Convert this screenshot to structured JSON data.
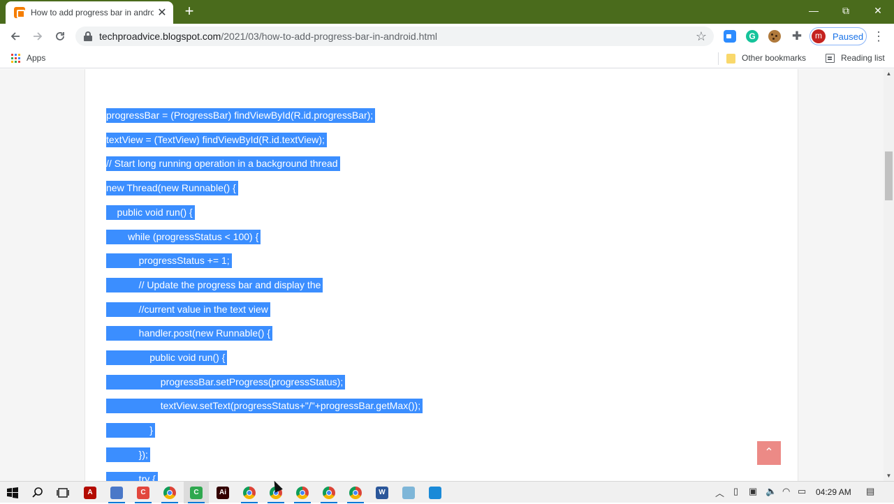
{
  "browser": {
    "tab_title": "How to add progress bar in android",
    "tab_close": "✕",
    "new_tab": "+",
    "window_controls": {
      "minimize": "—",
      "restore": "⧉",
      "close": "✕"
    },
    "url_host": "techproadvice.blogspot.com",
    "url_path": "/2021/03/how-to-add-progress-bar-in-android.html",
    "profile_initial": "m",
    "profile_status": "Paused",
    "grammarly_letter": "G"
  },
  "bookmarks": {
    "apps_label": "Apps",
    "other_label": "Other bookmarks",
    "reading_label": "Reading list",
    "apps_grid_colors": [
      "#ea4335",
      "#4285f4",
      "#fbbc05",
      "#34a853",
      "#ea4335",
      "#4285f4",
      "#fbbc05",
      "#34a853",
      "#ea4335"
    ]
  },
  "page": {
    "highlight_color": "#3b8eff",
    "code_lines": [
      "progressBar = (ProgressBar) findViewById(R.id.progressBar);",
      "textView = (TextView) findViewById(R.id.textView);",
      "// Start long running operation in a background thread",
      "new Thread(new Runnable() {",
      "    public void run() {",
      "        while (progressStatus < 100) {",
      "            progressStatus += 1;",
      "            // Update the progress bar and display the",
      "            //current value in the text view",
      "            handler.post(new Runnable() {",
      "                public void run() {",
      "                    progressBar.setProgress(progressStatus);",
      "                    textView.setText(progressStatus+\"/\"+progressBar.getMax());",
      "                }",
      "            });",
      "            try {"
    ],
    "scroll_top_glyph": "⌃"
  },
  "taskbar": {
    "clock": "04:29 AM",
    "items": [
      {
        "name": "windows-start-icon",
        "glyph": "",
        "color": "#000000",
        "active": false,
        "running": false
      },
      {
        "name": "search-icon",
        "glyph": "",
        "color": "#000000",
        "active": false,
        "running": false
      },
      {
        "name": "task-view-icon",
        "glyph": "",
        "color": "#000000",
        "active": false,
        "running": false
      },
      {
        "name": "acrobat-icon",
        "glyph": "A",
        "color": "#b30b00",
        "active": false,
        "running": false
      },
      {
        "name": "file-explorer-icon",
        "glyph": "",
        "color": "#4a78c8",
        "active": false,
        "running": true
      },
      {
        "name": "ccleaner-icon",
        "glyph": "C",
        "color": "#e2473d",
        "active": false,
        "running": true
      },
      {
        "name": "chrome-icon",
        "glyph": "",
        "color": "",
        "active": false,
        "running": true
      },
      {
        "name": "camtasia-icon",
        "glyph": "C",
        "color": "#2fa84f",
        "active": true,
        "running": true
      },
      {
        "name": "illustrator-icon",
        "glyph": "Ai",
        "color": "#330000",
        "active": false,
        "running": false
      },
      {
        "name": "chrome-icon",
        "glyph": "",
        "color": "",
        "active": false,
        "running": true
      },
      {
        "name": "chrome-icon",
        "glyph": "",
        "color": "",
        "active": false,
        "running": true
      },
      {
        "name": "chrome-icon",
        "glyph": "",
        "color": "",
        "active": false,
        "running": true
      },
      {
        "name": "chrome-icon",
        "glyph": "",
        "color": "",
        "active": false,
        "running": true
      },
      {
        "name": "chrome-icon",
        "glyph": "",
        "color": "",
        "active": false,
        "running": true
      },
      {
        "name": "word-icon",
        "glyph": "W",
        "color": "#2b579a",
        "active": false,
        "running": false
      },
      {
        "name": "notepad-icon",
        "glyph": "",
        "color": "#7eb6d8",
        "active": false,
        "running": false
      },
      {
        "name": "photos-icon",
        "glyph": "",
        "color": "#1a8ad8",
        "active": false,
        "running": false
      }
    ]
  }
}
